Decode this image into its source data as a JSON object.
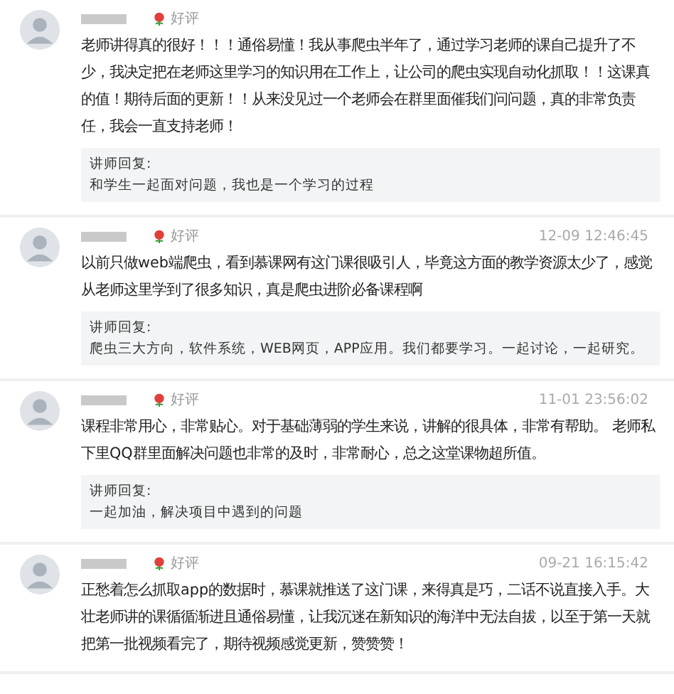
{
  "comments": [
    {
      "rating": "好评",
      "text": "老师讲得真的很好！！！通俗易懂！我从事爬虫半年了，通过学习老师的课自己提升了不少，我决定把在老师这里学习的知识用在工作上，让公司的爬虫实现自动化抓取！！这课真的值！期待后面的更新！！从来没见过一个老师会在群里面催我们问问题，真的非常负责任，我会一直支持老师！",
      "reply_label": "讲师回复:",
      "reply": "和学生一起面对问题，我也是一个学习的过程"
    },
    {
      "rating": "好评",
      "time": "12-09 12:46:45",
      "text": "以前只做web端爬虫，看到慕课网有这门课很吸引人，毕竟这方面的教学资源太少了，感觉从老师这里学到了很多知识，真是爬虫进阶必备课程啊",
      "reply_label": "讲师回复:",
      "reply": "爬虫三大方向，软件系统，WEB网页，APP应用。我们都要学习。一起讨论，一起研究。"
    },
    {
      "rating": "好评",
      "time": "11-01 23:56:02",
      "text": "课程非常用心，非常贴心。对于基础薄弱的学生来说，讲解的很具体，非常有帮助。 老师私下里QQ群里面解决问题也非常的及时，非常耐心，总之这堂课物超所值。",
      "reply_label": "讲师回复:",
      "reply": "一起加油，解决项目中遇到的问题"
    },
    {
      "rating": "好评",
      "time": "09-21 16:15:42",
      "text": "正愁着怎么抓取app的数据时，慕课就推送了这门课，来得真是巧，二话不说直接入手。大壮老师讲的课循循渐进且通俗易懂，让我沉迷在新知识的海洋中无法自拔，以至于第一天就把第一批视频看完了，期待视频感觉更新，赞赞赞！"
    }
  ]
}
